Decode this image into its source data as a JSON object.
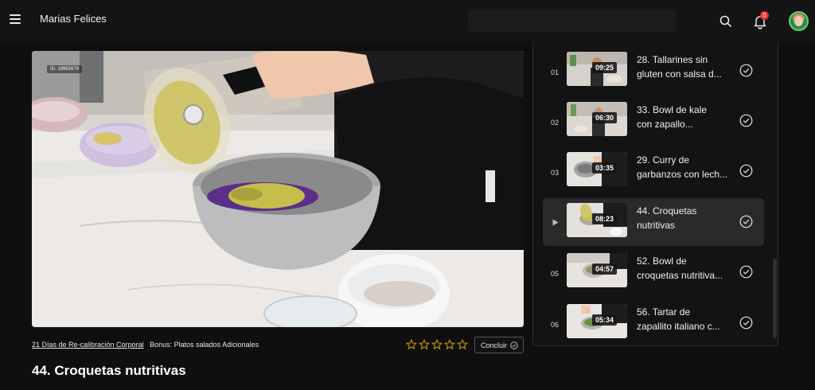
{
  "header": {
    "app_title": "Marias Felices",
    "notification_count": "0",
    "icons": [
      "menu-icon",
      "search-icon",
      "bell-icon",
      "avatar"
    ]
  },
  "video": {
    "id_label": "ID: 19992679"
  },
  "meta": {
    "course_link": "21 Días de Re-calibración Corporal",
    "section": "Bonus: Platos salados Adicionales",
    "rating": 0,
    "rating_max": 5,
    "complete_button": "Concluir"
  },
  "lesson": {
    "title": "44. Croquetas nutritivas"
  },
  "playlist": {
    "items": [
      {
        "index": "01",
        "duration": "09:25",
        "title_line1": "28. Tallarines sin",
        "title_line2": "gluten con salsa d...",
        "completed": true,
        "active": false
      },
      {
        "index": "02",
        "duration": "06:30",
        "title_line1": "33. Bowl de kale",
        "title_line2": "con zapallo...",
        "completed": true,
        "active": false
      },
      {
        "index": "03",
        "duration": "03:35",
        "title_line1": "29. Curry de",
        "title_line2": "garbanzos con lech...",
        "completed": true,
        "active": false
      },
      {
        "index": "",
        "duration": "08:23",
        "title_line1": "44. Croquetas",
        "title_line2": "nutritivas",
        "completed": true,
        "active": true
      },
      {
        "index": "05",
        "duration": "04:57",
        "title_line1": "52. Bowl de",
        "title_line2": "croquetas nutritiva...",
        "completed": true,
        "active": false
      },
      {
        "index": "06",
        "duration": "05:34",
        "title_line1": "56. Tartar de",
        "title_line2": "zapallito italiano c...",
        "completed": true,
        "active": false
      }
    ]
  },
  "colors": {
    "background": "#0f0f0f",
    "active_item": "#2a2a2a",
    "badge": "#e03131",
    "star": "#d9a400"
  }
}
